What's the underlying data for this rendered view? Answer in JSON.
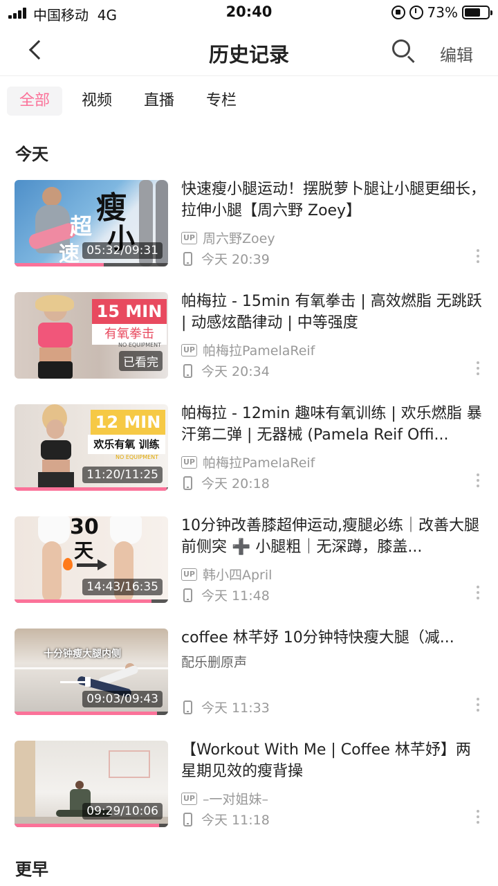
{
  "status_bar": {
    "carrier": "中国移动",
    "network": "4G",
    "time": "20:40",
    "battery": "73%",
    "battery_level": 0.73
  },
  "nav": {
    "title": "历史记录",
    "edit": "编辑",
    "icons": [
      "back-chevron-icon",
      "search-icon"
    ]
  },
  "tabs": [
    {
      "label": "全部",
      "active": true
    },
    {
      "label": "视频",
      "active": false
    },
    {
      "label": "直播",
      "active": false
    },
    {
      "label": "专栏",
      "active": false
    }
  ],
  "sections": {
    "today": "今天",
    "earlier": "更早"
  },
  "colors": {
    "accent": "#fb7299",
    "text": "#222222",
    "meta": "#999999"
  },
  "items": [
    {
      "title": "快速瘦小腿运动！摆脱萝卜腿让小腿更细长，拉伸小腿【周六野 Zoey】",
      "author": "周六野Zoey",
      "time": "今天 20:39",
      "duration": "05:32/09:31",
      "progress": 0.58,
      "thumb_text": [
        "瘦",
        "超",
        "小",
        "速"
      ]
    },
    {
      "title": "帕梅拉 - 15min 有氧拳击 | 高效燃脂 无跳跃 | 动感炫酷律动 | 中等强度",
      "author": "帕梅拉PamelaReif",
      "time": "今天 20:34",
      "duration": "已看完",
      "progress": 1.0,
      "thumb_text": [
        "15 MIN",
        "有氧拳击",
        "NO EQUIPMENT"
      ]
    },
    {
      "title": "帕梅拉 - 12min 趣味有氧训练 | 欢乐燃脂 暴汗第二弹 | 无器械 (Pamela Reif Offi...",
      "author": "帕梅拉PamelaReif",
      "time": "今天 20:18",
      "duration": "11:20/11:25",
      "progress": 0.99,
      "thumb_text": [
        "12 MIN",
        "欢乐有氧 训练",
        "NO EQUIPMENT"
      ]
    },
    {
      "title": "10分钟改善膝超伸运动,瘦腿必练｜改善大腿前侧突 ➕ 小腿粗｜无深蹲，膝盖...",
      "author": "韩小四April",
      "time": "今天 11:48",
      "duration": "14:43/16:35",
      "progress": 0.89,
      "thumb_text": [
        "30",
        "天"
      ]
    },
    {
      "title": "coffee 林芊妤 10分钟特快瘦大腿（减...",
      "author": "",
      "subtitle": "配乐删原声",
      "time": "今天 11:33",
      "duration": "09:03/09:43",
      "progress": 0.93,
      "thumb_text": [
        "十分钟瘦大腿内侧"
      ]
    },
    {
      "title": "【Workout With Me | Coffee 林芊妤】两星期见效的瘦背操",
      "author": "–一对姐妹–",
      "time": "今天 11:18",
      "duration": "09:29/10:06",
      "progress": 0.94,
      "thumb_text": []
    }
  ]
}
